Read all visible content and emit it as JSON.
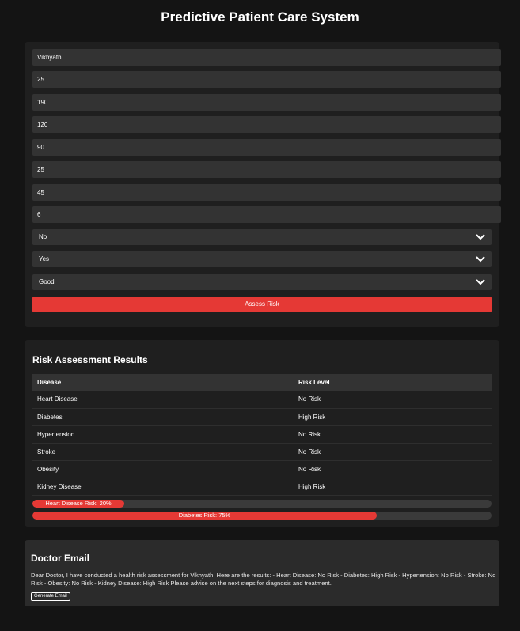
{
  "app_title": "Predictive Patient Care System",
  "form": {
    "fields": [
      "Vikhyath",
      "25",
      "190",
      "120",
      "90",
      "25",
      "45",
      "6"
    ],
    "selects": [
      "No",
      "Yes",
      "Good"
    ],
    "assess_button": "Assess Risk"
  },
  "results": {
    "title": "Risk Assessment Results",
    "headers": [
      "Disease",
      "Risk Level"
    ],
    "rows": [
      {
        "disease": "Heart Disease",
        "risk": "No Risk"
      },
      {
        "disease": "Diabetes",
        "risk": "High Risk"
      },
      {
        "disease": "Hypertension",
        "risk": "No Risk"
      },
      {
        "disease": "Stroke",
        "risk": "No Risk"
      },
      {
        "disease": "Obesity",
        "risk": "No Risk"
      },
      {
        "disease": "Kidney Disease",
        "risk": "High Risk"
      }
    ],
    "bars": [
      {
        "label": "Heart Disease Risk: 20%",
        "percent": 20
      },
      {
        "label": "Diabetes Risk: 75%",
        "percent": 75
      }
    ]
  },
  "email": {
    "title": "Doctor Email",
    "body": "Dear Doctor, I have conducted a health risk assessment for Vikhyath. Here are the results: - Heart Disease: No Risk - Diabetes: High Risk - Hypertension: No Risk - Stroke: No Risk - Obesity: No Risk - Kidney Disease: High Risk Please advise on the next steps for diagnosis and treatment.",
    "button": "Generate Email"
  },
  "colors": {
    "accent": "#e53935",
    "background": "#141414",
    "card": "#1f1f1f"
  },
  "icons": {
    "select": "chevron-down-icon"
  }
}
